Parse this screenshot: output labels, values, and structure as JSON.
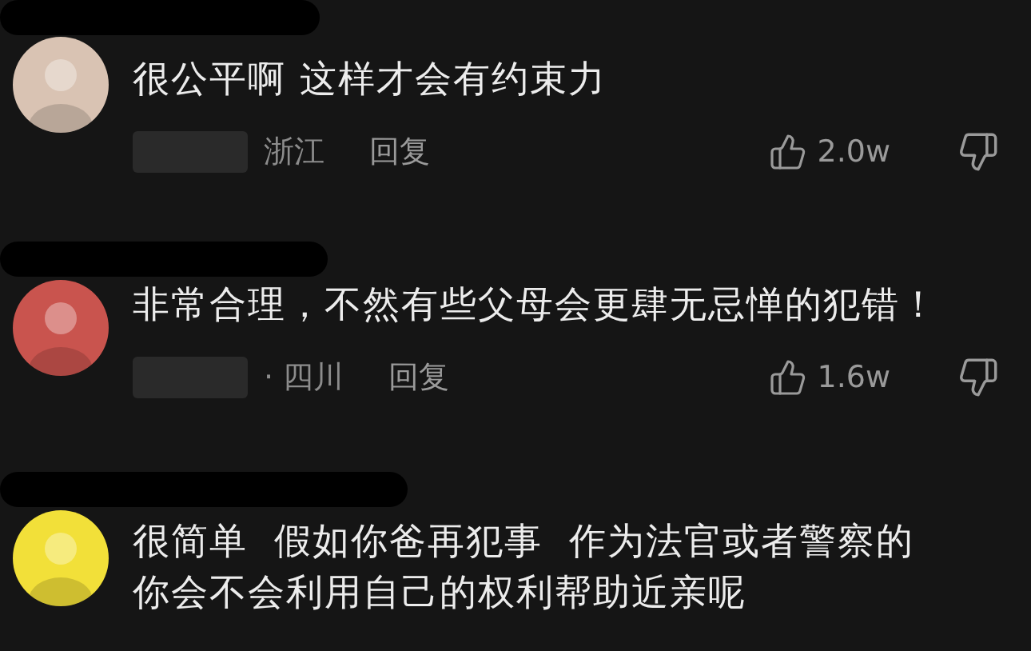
{
  "comments": [
    {
      "color": "#d9c3b3",
      "text": "很公平啊 这样才会有约束力",
      "meta": {
        "location": "浙江",
        "reply": "回复",
        "likes": "2.0w"
      }
    },
    {
      "color": "#c9544e",
      "text": "非常合理，不然有些父母会更肆无忌惮的犯错！",
      "meta": {
        "location": "· 四川",
        "reply": "回复",
        "likes": "1.6w"
      }
    },
    {
      "color": "#f2e039",
      "text": "很简单  假如你爸再犯事  作为法官或者警察的你会不会利用自己的权利帮助近亲呢"
    }
  ]
}
